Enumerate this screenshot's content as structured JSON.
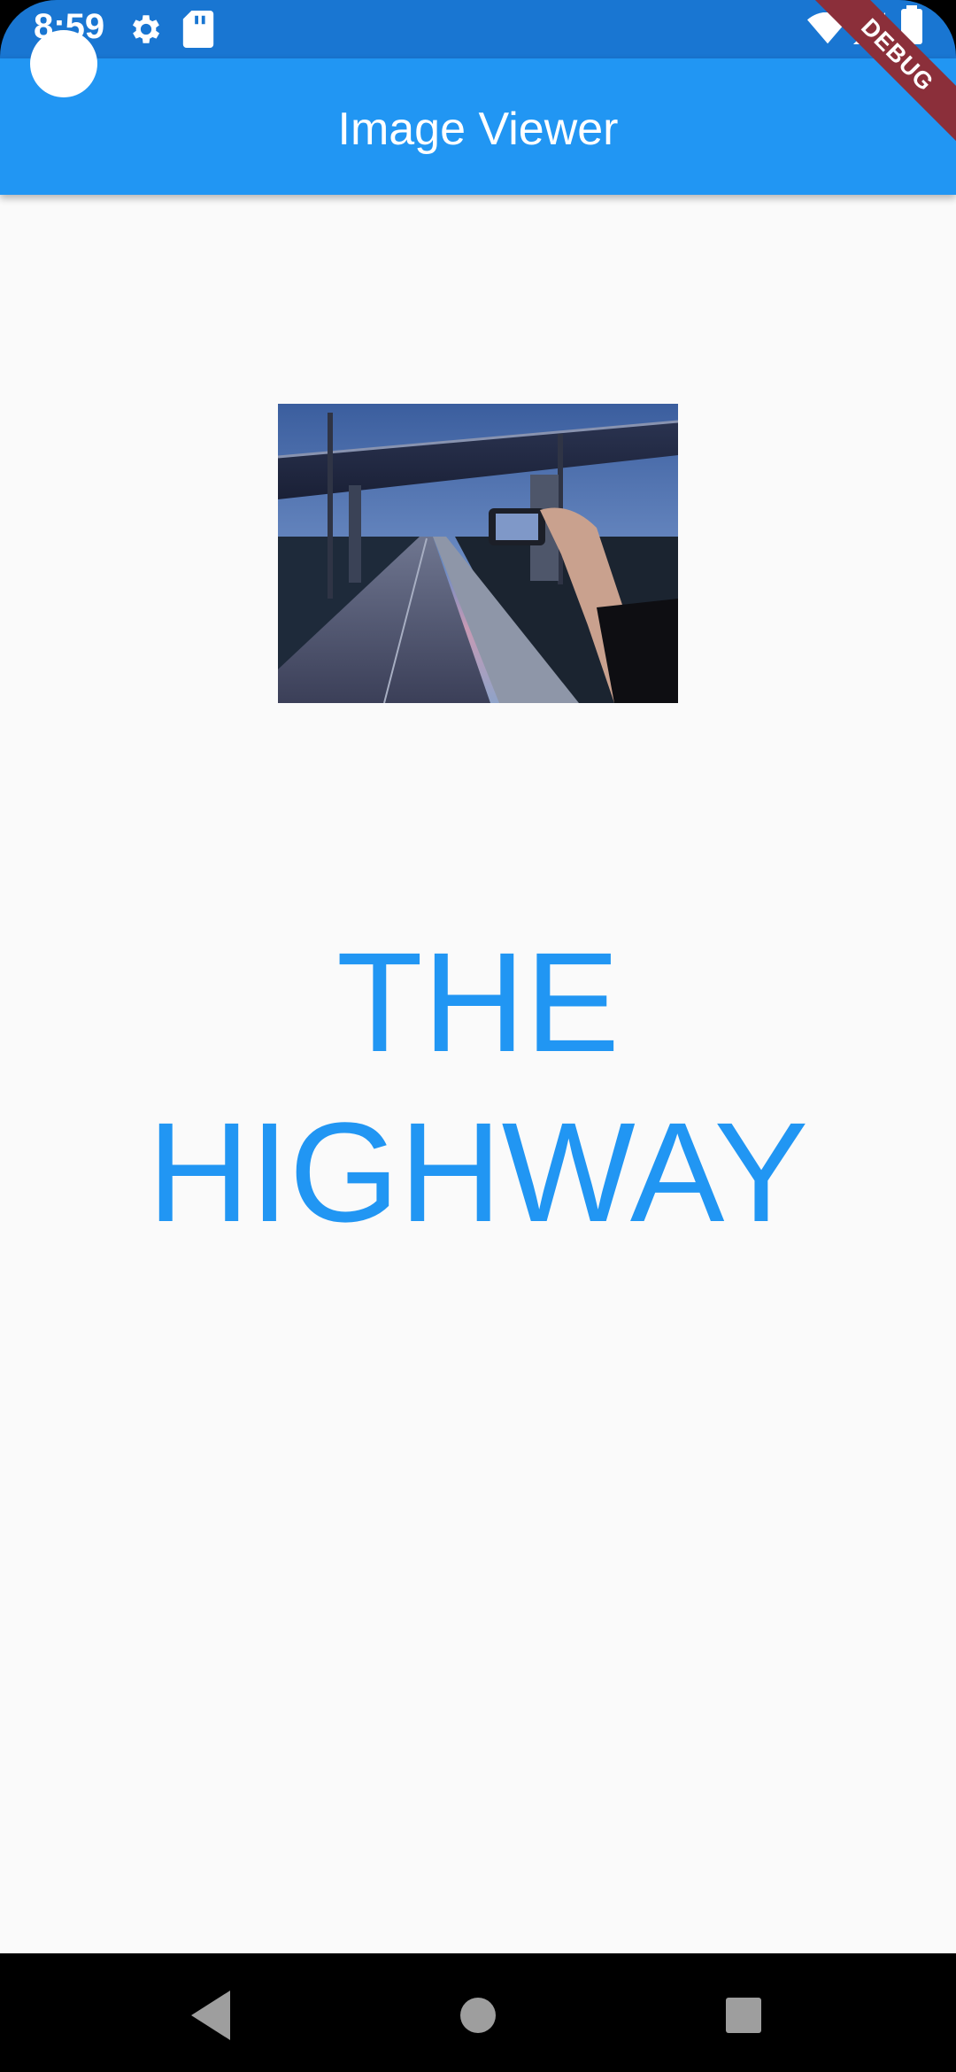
{
  "status_bar": {
    "time": "8:59",
    "icons": [
      "gear-icon",
      "sd-card-icon",
      "wifi-icon",
      "signal-icon",
      "battery-icon"
    ]
  },
  "debug_banner": "DEBUG",
  "app_bar": {
    "title": "Image Viewer"
  },
  "main": {
    "image_subject": "highway-overpass-photo",
    "caption": "THE HIGHWAY"
  },
  "nav_bar": {
    "buttons": [
      "back-icon",
      "home-icon",
      "recents-icon"
    ]
  },
  "colors": {
    "status_bar": "#1976D2",
    "app_bar": "#2196F3",
    "caption": "#2196F3",
    "background": "#FAFAFA",
    "debug_ribbon": "#8B2F3A"
  }
}
